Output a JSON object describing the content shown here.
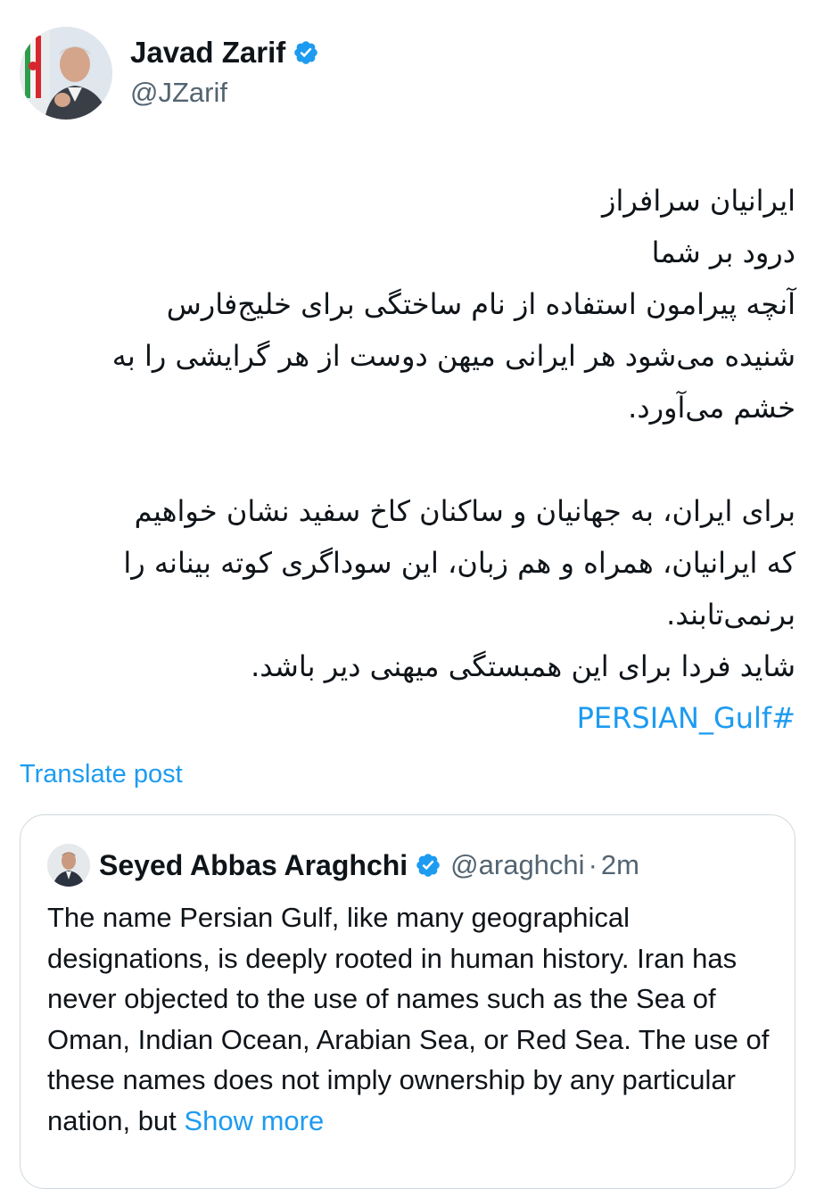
{
  "author": {
    "name": "Javad Zarif",
    "handle": "@JZarif"
  },
  "tweet": {
    "lines_para1": [
      "ایرانیان سرافراز",
      "درود بر شما",
      "آنچه پیرامون استفاده از نام ساختگی برای خلیج‌فارس",
      "شنیده می‌شود هر ایرانی میهن دوست از هر گرایشی را به",
      "خشم می‌آورد."
    ],
    "lines_para2": [
      "برای ایران، به جهانیان و ساکنان کاخ سفید نشان خواهیم",
      "که ایرانیان، همراه و هم زبان، این سوداگری کوته بینانه را",
      "برنمی‌تابند.",
      "شاید فردا برای این همبستگی میهنی دیر باشد."
    ],
    "hashtag": "#PERSIAN_Gulf",
    "translate_label": "Translate post"
  },
  "quote": {
    "name": "Seyed Abbas Araghchi",
    "handle": "@araghchi",
    "dot": "·",
    "time": "2m",
    "text": "The name Persian Gulf, like many geographical designations, is deeply rooted in human history. Iran has never objected to the use of names such as the Sea of Oman, Indian Ocean, Arabian Sea, or Red Sea. The use of these names does not imply ownership by any particular nation, but",
    "show_more": "Show more"
  },
  "icons": {
    "verified": "verified-badge-icon"
  },
  "colors": {
    "link": "#1d9bf0",
    "secondary_text": "#536471",
    "border": "#cfd9de"
  }
}
